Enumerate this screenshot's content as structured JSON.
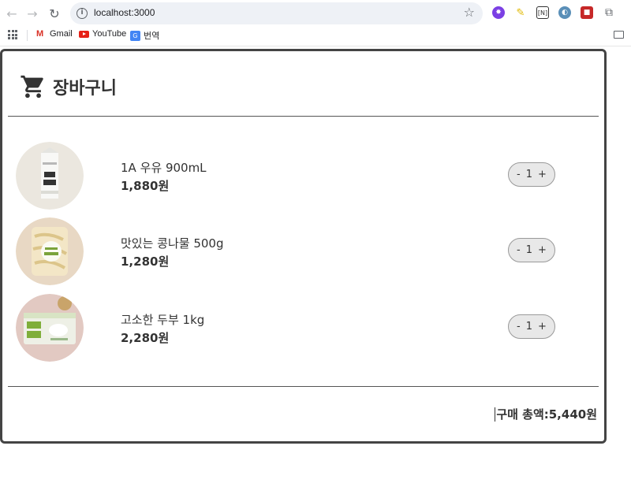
{
  "browser": {
    "url": "localhost:3000",
    "bookmarks": [
      {
        "label": "Gmail",
        "icon": "gmail-icon"
      },
      {
        "label": "YouTube",
        "icon": "youtube-icon"
      },
      {
        "label": "번역",
        "icon": "translate-icon"
      }
    ]
  },
  "cart": {
    "title": "장바구니",
    "items": [
      {
        "name": "1A 우유 900mL",
        "price": "1,880원",
        "qty": "1",
        "minus": "-",
        "plus": "+"
      },
      {
        "name": "맛있는 콩나물 500g",
        "price": "1,280원",
        "qty": "1",
        "minus": "-",
        "plus": "+"
      },
      {
        "name": "고소한 두부 1kg",
        "price": "2,280원",
        "qty": "1",
        "minus": "-",
        "plus": "+"
      }
    ],
    "total_label": "구매 총액:",
    "total_value": "5,440원"
  },
  "colors": {
    "border": "#444444",
    "text": "#333333",
    "qty_bg": "#e8e8e8"
  }
}
